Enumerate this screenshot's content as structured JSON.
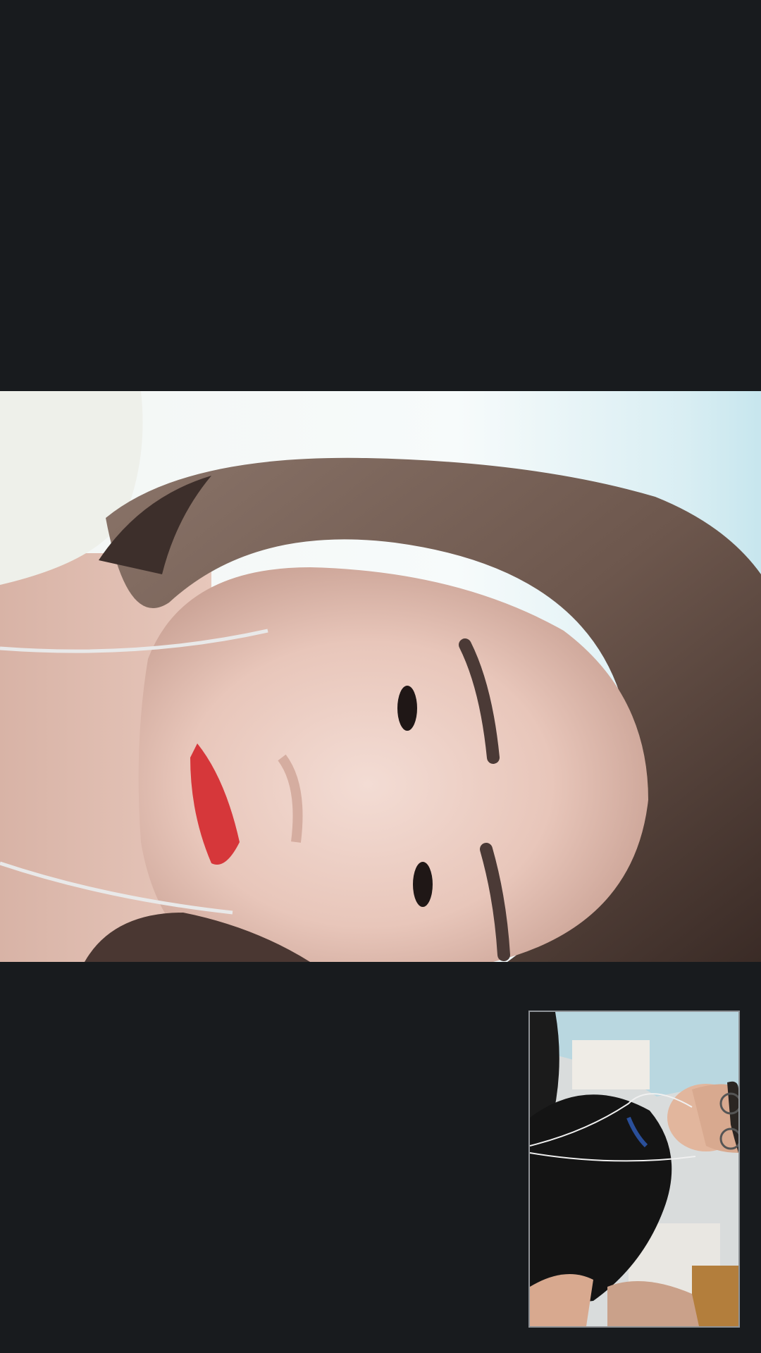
{
  "app": {
    "screen_type": "video-call",
    "background_color": "#181b1e"
  },
  "remote_feed": {
    "kind": "camera-video",
    "orientation": "rotated-90"
  },
  "self_view": {
    "kind": "camera-video",
    "border_color": "#8e9296"
  }
}
